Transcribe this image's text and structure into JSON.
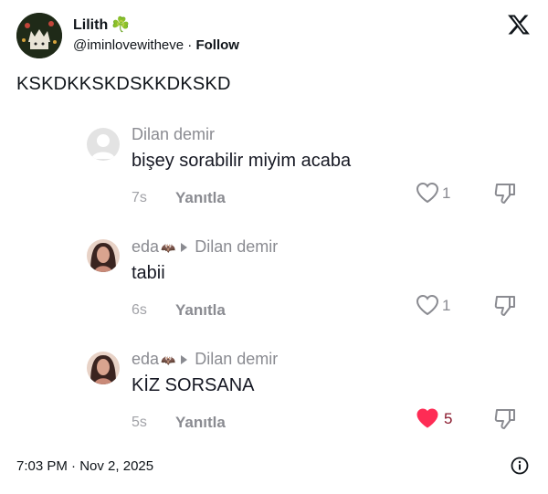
{
  "author": {
    "display_name": "Lilith",
    "name_emoji": "☘️",
    "handle": "@iminlovewitheve",
    "separator": "·",
    "follow_label": "Follow"
  },
  "tweet": {
    "text": "KSKDKKSKDSKKDKSKD",
    "time": "7:03 PM",
    "date": "Nov 2, 2025",
    "separator": "·"
  },
  "comments": [
    {
      "user": "Dilan demir",
      "reply_to": "",
      "text": "bişey sorabilir miyim acaba",
      "time": "7s",
      "reply_label": "Yanıtla",
      "likes": "1",
      "liked": false
    },
    {
      "user": "eda",
      "user_emoji": "🦇",
      "reply_to": "Dilan demir",
      "text": "tabii",
      "time": "6s",
      "reply_label": "Yanıtla",
      "likes": "1",
      "liked": false
    },
    {
      "user": "eda",
      "user_emoji": "🦇",
      "reply_to": "Dilan demir",
      "text": "KİZ SORSANA",
      "time": "5s",
      "reply_label": "Yanıtla",
      "likes": "5",
      "liked": true
    }
  ],
  "colors": {
    "like_active": "#fe2c55",
    "meta_gray": "#8a8b91"
  },
  "icons": [
    "x-logo-icon",
    "heart-icon",
    "dislike-icon",
    "info-icon",
    "clover-icon",
    "bat-icon"
  ]
}
